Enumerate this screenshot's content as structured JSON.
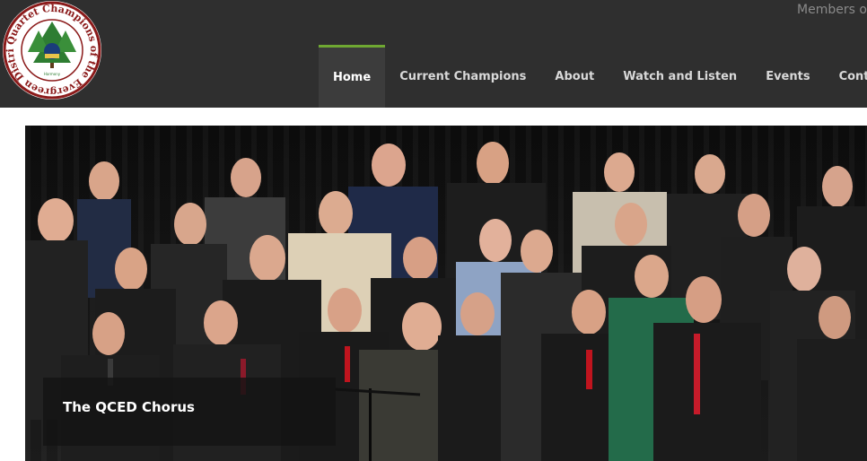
{
  "header": {
    "logo_alt": "Quartet Champions of the Evergreen District",
    "logo_text_top": "Quartet Champions of the Evergreen District",
    "members_link": "Members or",
    "nav": [
      {
        "label": "Home",
        "active": true
      },
      {
        "label": "Current Champions",
        "active": false
      },
      {
        "label": "About",
        "active": false
      },
      {
        "label": "Watch and Listen",
        "active": false
      },
      {
        "label": "Events",
        "active": false
      },
      {
        "label": "Contact",
        "active": false
      }
    ]
  },
  "hero": {
    "caption": "The QCED Chorus",
    "image_description": "Chorus of men singing on stage"
  },
  "colors": {
    "header_bg": "#2f2f2f",
    "nav_active_bar": "#6fa832",
    "logo_green": "#2e7d32",
    "logo_red": "#8b1a1a"
  }
}
